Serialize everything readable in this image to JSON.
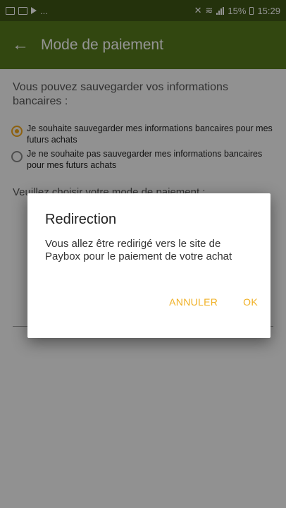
{
  "status_bar": {
    "left": "...",
    "battery": "15%",
    "time": "15:29"
  },
  "app_bar": {
    "back_icon": "arrow-left-icon",
    "title": "Mode de paiement"
  },
  "page": {
    "intro": "Vous pouvez sauvegarder vos informations bancaires :",
    "options": [
      {
        "label": "Je souhaite sauvegarder mes informations bancaires pour mes futurs achats",
        "selected": true
      },
      {
        "label": "Je ne souhaite pas sauvegarder mes informations bancaires pour mes futurs achats",
        "selected": false
      }
    ],
    "choose_text": "Veuillez choisir votre mode de paiement :"
  },
  "dialog": {
    "title": "Redirection",
    "message": "Vous allez être redirigé vers le site de Paybox pour le paiement de votre achat",
    "cancel_label": "ANNULER",
    "ok_label": "OK"
  },
  "colors": {
    "primary": "#577a1d",
    "primary_dark": "#3f5715",
    "accent": "#f3a81c"
  }
}
